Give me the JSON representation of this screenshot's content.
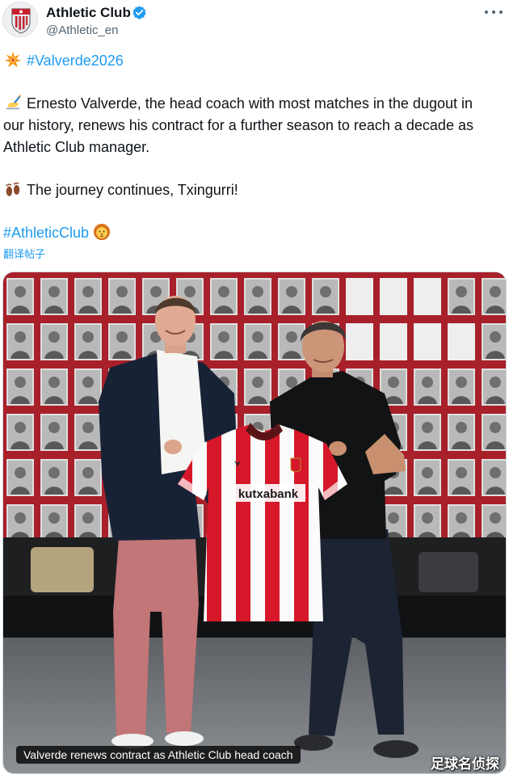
{
  "author": {
    "name": "Athletic Club",
    "handle": "@Athletic_en",
    "verified": true,
    "avatar_icon": "athletic-club-crest-icon"
  },
  "tweet": {
    "hashtag_line": "#Valverde2026",
    "paragraph1_lines": [
      "Ernesto Valverde, the head coach with most matches in the dugout in",
      "our history, renews his contract for a further season to reach a decade as",
      "Athletic Club manager."
    ],
    "paragraph2": "The journey continues, Txingurri!",
    "closing_hashtag": "#AthleticClub",
    "translate_link": "翻译帖子",
    "emojis": {
      "collision": "collision-icon",
      "writing_hand": "writing-hand-icon",
      "footprints": "footprints-icon",
      "lion": "lion-face-icon"
    }
  },
  "media": {
    "caption": "Valverde renews contract as Athletic Club head coach",
    "watermark": "足球名侦探",
    "shirt_sponsor": "kutxabank"
  },
  "colors": {
    "link": "#1d9bf0",
    "verified": "#1d9bf0",
    "text": "#0f1419",
    "secondary_text": "#536471",
    "shirt_red": "#d6182a",
    "wall_red": "#a8202a"
  }
}
